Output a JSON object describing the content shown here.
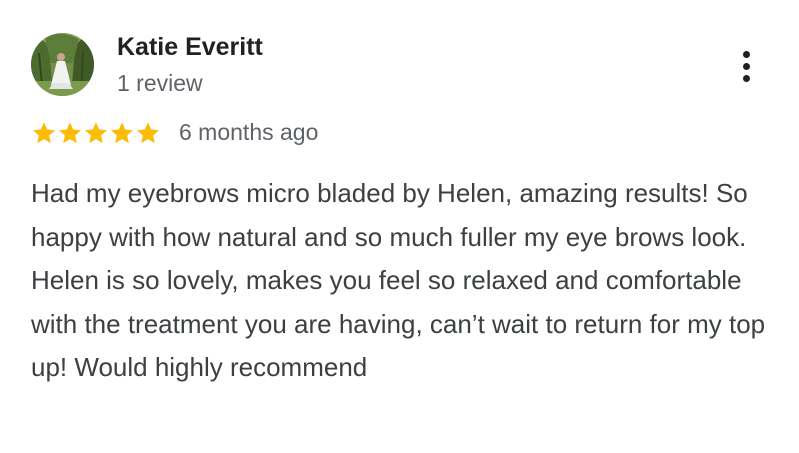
{
  "reviewer": {
    "name": "Katie Everitt",
    "review_count": "1 review",
    "avatar_icon": "profile-photo-avatar"
  },
  "menu": {
    "icon": "more-vertical-icon"
  },
  "rating": {
    "stars": 5,
    "max_stars": 5,
    "star_color": "#fbbc04",
    "star_icon": "star-icon",
    "date": "6 months ago"
  },
  "review": {
    "text": "Had my eyebrows micro bladed by Helen, amazing results! So happy with how natural and so much fuller my eye brows look. Helen is so lovely, makes you feel so relaxed and comfortable with the treatment you are having, can’t wait to return for my top up! Would highly recommend"
  }
}
